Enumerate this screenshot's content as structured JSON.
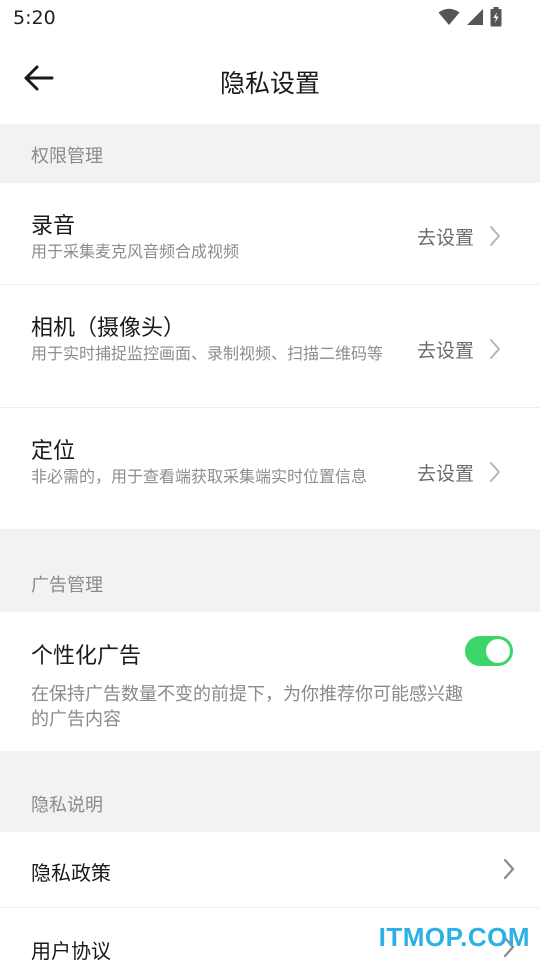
{
  "status_bar": {
    "time": "5:20"
  },
  "header": {
    "title": "隐私设置"
  },
  "permissions": {
    "section_title": "权限管理",
    "items": [
      {
        "title": "录音",
        "desc": "用于采集麦克风音频合成视频",
        "action": "去设置"
      },
      {
        "title": "相机（摄像头）",
        "desc": "用于实时捕捉监控画面、录制视频、扫描二维码等",
        "action": "去设置"
      },
      {
        "title": "定位",
        "desc": "非必需的，用于查看端获取采集端实时位置信息",
        "action": "去设置"
      }
    ]
  },
  "ads": {
    "section_title": "广告管理",
    "item": {
      "title": "个性化广告",
      "desc": "在保持广告数量不变的前提下，为你推荐你可能感兴趣的广告内容",
      "enabled": true
    }
  },
  "privacy": {
    "section_title": "隐私说明",
    "items": [
      {
        "title": "隐私政策"
      },
      {
        "title": "用户协议"
      }
    ]
  },
  "watermark": "ITMOP.COM",
  "colors": {
    "accent": "#3bd667",
    "watermark": "#2bb0e8",
    "background": "#f2f2f2"
  }
}
